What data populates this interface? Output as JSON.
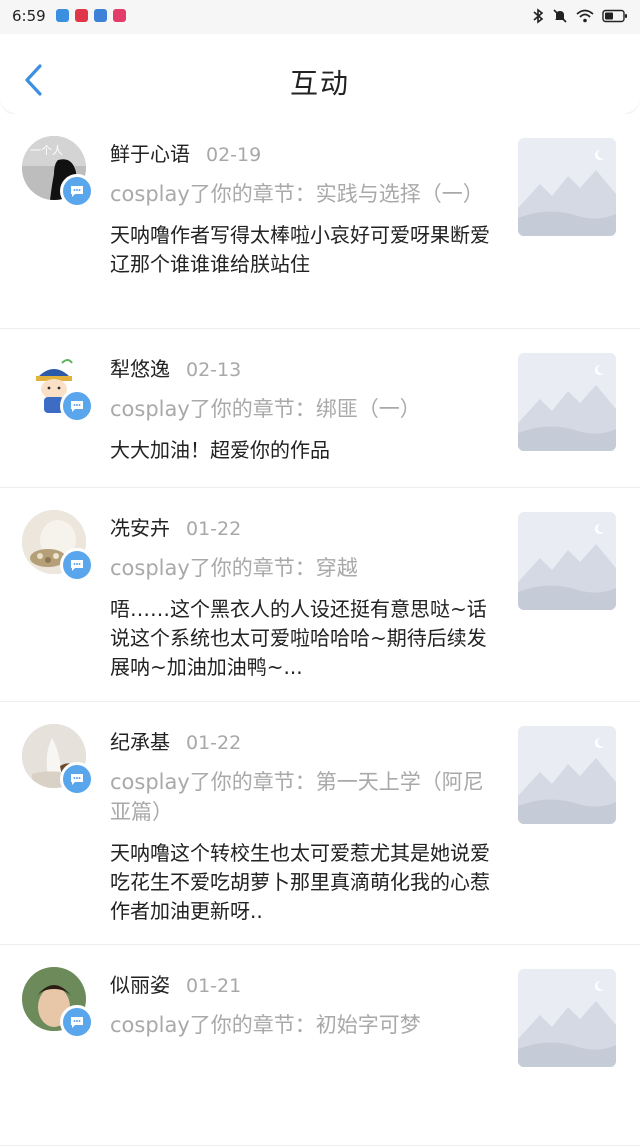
{
  "status_bar": {
    "time": "6:59",
    "app_icon_colors": [
      "#3a8fe0",
      "#e0364a",
      "#3d82d6",
      "#e23c6a"
    ]
  },
  "header": {
    "back_icon": "chevron-left-icon",
    "title": "互动"
  },
  "colors": {
    "accent": "#3d8fe0",
    "badge": "#5aa6ec"
  },
  "items": [
    {
      "name": "鲜于心语",
      "date": "02-19",
      "chapter": "cosplay了你的章节：实践与选择（一）",
      "comment": "天呐噜作者写得太棒啦小哀好可爱呀果断爱辽那个谁谁谁给朕站住",
      "avatar_text": "一个人"
    },
    {
      "name": "犁悠逸",
      "date": "02-13",
      "chapter": "cosplay了你的章节：绑匪（一）",
      "comment": "大大加油！超爱你的作品"
    },
    {
      "name": "冼安卉",
      "date": "01-22",
      "chapter": "cosplay了你的章节：穿越",
      "comment": "唔……这个黑衣人的人设还挺有意思哒~话说这个系统也太可爱啦哈哈哈~期待后续发展呐~加油加油鸭~..."
    },
    {
      "name": "纪承基",
      "date": "01-22",
      "chapter": "cosplay了你的章节：第一天上学（阿尼亚篇）",
      "comment": "天呐噜这个转校生也太可爱惹尤其是她说爱吃花生不爱吃胡萝卜那里真滴萌化我的心惹作者加油更新呀.."
    },
    {
      "name": "似丽姿",
      "date": "01-21",
      "chapter": "cosplay了你的章节：初始字可梦",
      "comment": ""
    }
  ]
}
